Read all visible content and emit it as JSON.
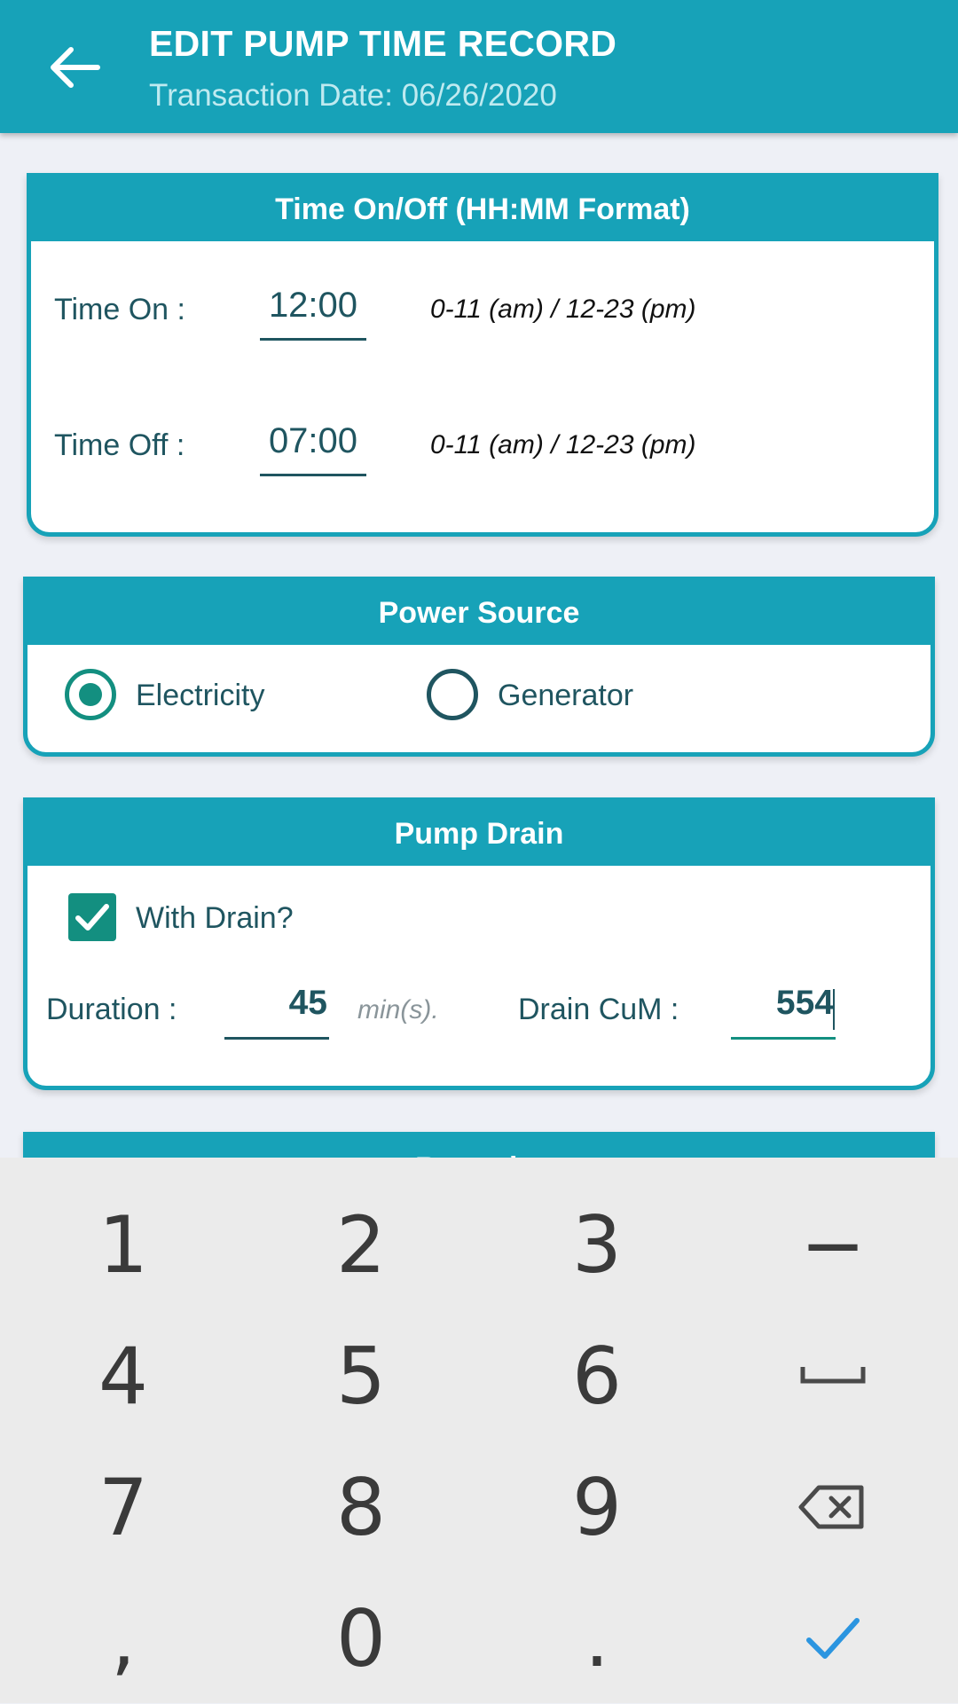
{
  "appbar": {
    "title": "EDIT PUMP TIME RECORD",
    "subtitle": "Transaction Date: 06/26/2020",
    "back_icon": "arrow-left-icon"
  },
  "time_card": {
    "header": "Time On/Off (HH:MM Format)",
    "time_on_label": "Time On :",
    "time_on_value": "12:00",
    "time_off_label": "Time Off :",
    "time_off_value": "07:00",
    "hint": "0-11 (am) / 12-23 (pm)"
  },
  "power_card": {
    "header": "Power Source",
    "options": [
      "Electricity",
      "Generator"
    ],
    "selected": "Electricity"
  },
  "drain_card": {
    "header": "Pump Drain",
    "with_drain_label": "With Drain?",
    "with_drain_checked": true,
    "duration_label": "Duration :",
    "duration_value": "45",
    "duration_unit": "min(s).",
    "drain_cum_label": "Drain CuM :",
    "drain_cum_value": "554"
  },
  "next_card": {
    "header": "Remarks"
  },
  "keypad": {
    "keys": [
      "1",
      "2",
      "3",
      "−",
      "4",
      "5",
      "6",
      "␣",
      "7",
      "8",
      "9",
      "⌫",
      ",",
      "0",
      ".",
      "✓"
    ],
    "special_icons": {
      "space": "space-bar-icon",
      "backspace": "backspace-icon",
      "done": "checkmark-icon"
    },
    "done_color": "#2b95e0"
  },
  "colors": {
    "primary": "#17a2b8",
    "accent": "#138f80",
    "text": "#1f5560"
  }
}
